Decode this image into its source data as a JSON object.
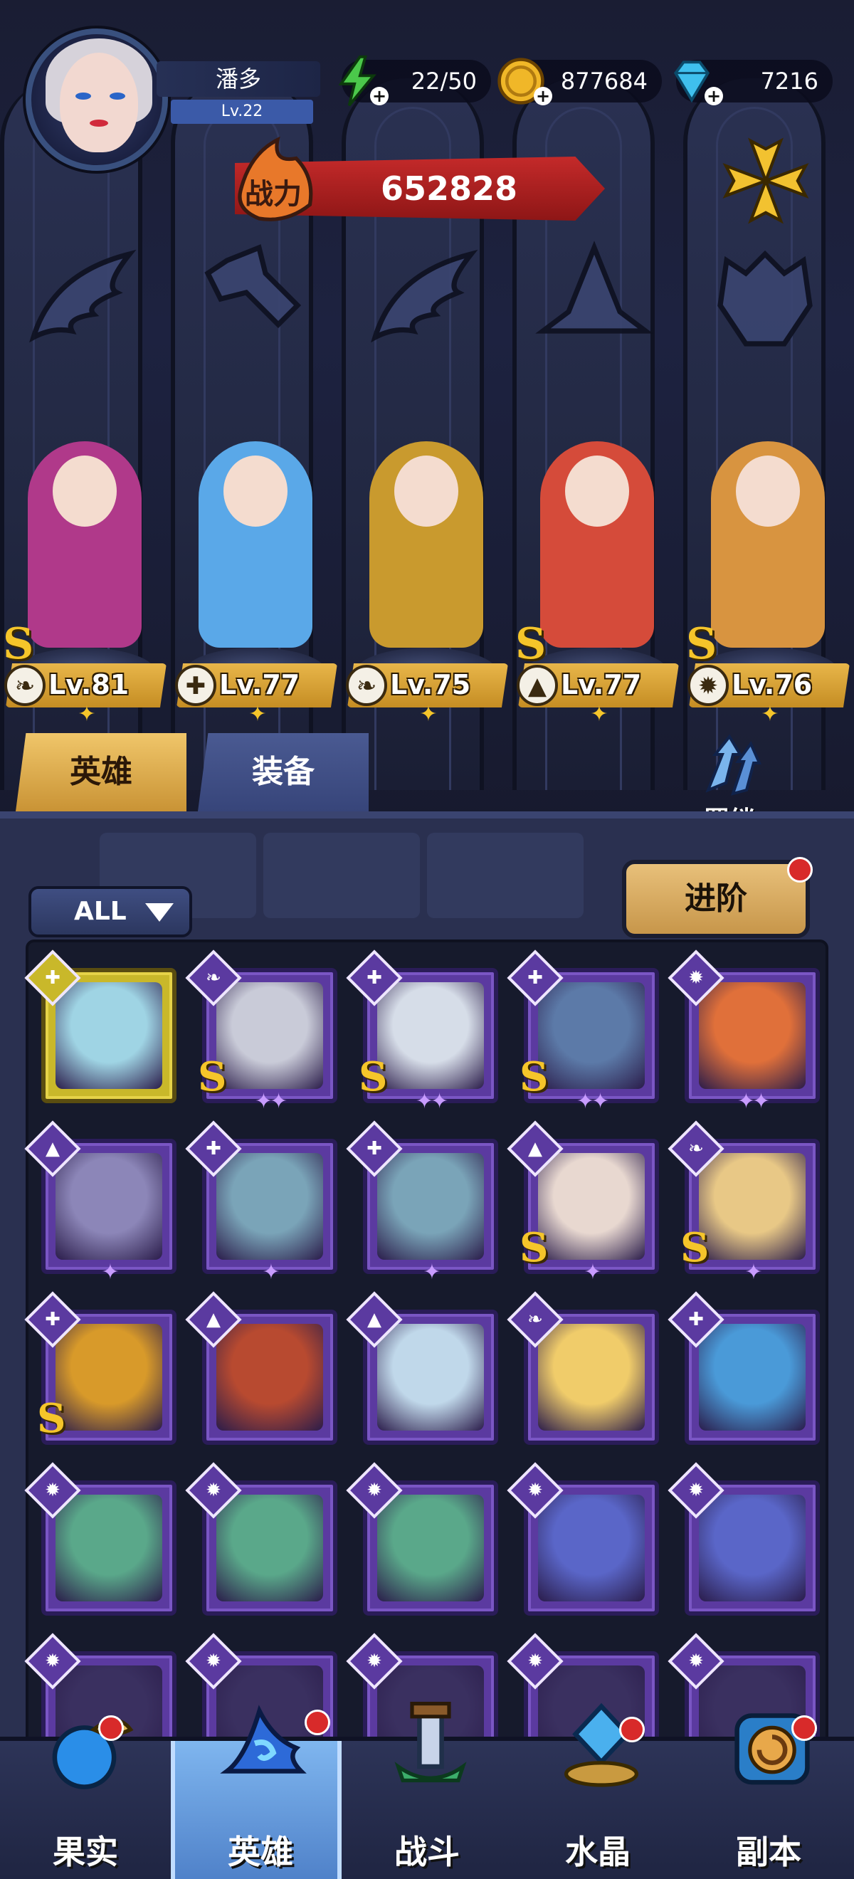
{
  "player": {
    "name": "潘多",
    "level": "Lv.22"
  },
  "resources": {
    "energy": "22/50",
    "gold": "877684",
    "gems": "7216"
  },
  "power": {
    "label": "战力",
    "value": "652828"
  },
  "stage_heroes": [
    {
      "level": "Lv.81",
      "rank": "S",
      "class_icon": "wing-icon",
      "color": "#b0398a"
    },
    {
      "level": "Lv.77",
      "rank": "",
      "class_icon": "wrench-icon",
      "color": "#5aa8e8"
    },
    {
      "level": "Lv.75",
      "rank": "",
      "class_icon": "wing-icon",
      "color": "#c99a2e"
    },
    {
      "level": "Lv.77",
      "rank": "S",
      "class_icon": "hat-icon",
      "color": "#d54b3a"
    },
    {
      "level": "Lv.76",
      "rank": "S",
      "class_icon": "beast-icon",
      "color": "#d89440"
    }
  ],
  "tabs": {
    "heroes": "英雄",
    "equipment": "装备"
  },
  "bond_label": "羁绊",
  "filter": {
    "selected": "ALL"
  },
  "advance_label": "进阶",
  "hero_cards": [
    {
      "class": "wrench",
      "rank": "",
      "stars": 0,
      "frame": "gold",
      "art": "#9fd4e4"
    },
    {
      "class": "wing",
      "rank": "S",
      "stars": 2,
      "frame": "purple",
      "art": "#c9cbd8"
    },
    {
      "class": "wrench",
      "rank": "S",
      "stars": 2,
      "frame": "purple",
      "art": "#d6dde8"
    },
    {
      "class": "wrench",
      "rank": "S",
      "stars": 2,
      "frame": "purple",
      "art": "#5c7aa8"
    },
    {
      "class": "beast",
      "rank": "",
      "stars": 2,
      "frame": "purple",
      "art": "#e0703a"
    },
    {
      "class": "hat",
      "rank": "",
      "stars": 1,
      "frame": "purple",
      "art": "#8c86b8"
    },
    {
      "class": "wrench",
      "rank": "",
      "stars": 1,
      "frame": "purple",
      "art": "#7aa4b8"
    },
    {
      "class": "wrench",
      "rank": "",
      "stars": 1,
      "frame": "purple",
      "art": "#7aa4b8"
    },
    {
      "class": "hat",
      "rank": "S",
      "stars": 1,
      "frame": "purple",
      "art": "#e8d8d0"
    },
    {
      "class": "wing",
      "rank": "S",
      "stars": 1,
      "frame": "purple",
      "art": "#e8c886"
    },
    {
      "class": "wrench",
      "rank": "S",
      "stars": 0,
      "frame": "purple",
      "art": "#d89a2a"
    },
    {
      "class": "hat",
      "rank": "",
      "stars": 0,
      "frame": "purple",
      "art": "#b84a30"
    },
    {
      "class": "hat",
      "rank": "",
      "stars": 0,
      "frame": "purple",
      "art": "#c0d8ea"
    },
    {
      "class": "wing",
      "rank": "",
      "stars": 0,
      "frame": "purple",
      "art": "#f0cc6a"
    },
    {
      "class": "wrench",
      "rank": "",
      "stars": 0,
      "frame": "purple",
      "art": "#4a9ad8"
    },
    {
      "class": "beast",
      "rank": "",
      "stars": 0,
      "frame": "purple",
      "art": "#5aa88a"
    },
    {
      "class": "beast",
      "rank": "",
      "stars": 0,
      "frame": "purple",
      "art": "#5aa88a"
    },
    {
      "class": "beast",
      "rank": "",
      "stars": 0,
      "frame": "purple",
      "art": "#5aa88a"
    },
    {
      "class": "beast",
      "rank": "",
      "stars": 0,
      "frame": "purple",
      "art": "#5a66c8"
    },
    {
      "class": "beast",
      "rank": "",
      "stars": 0,
      "frame": "purple",
      "art": "#5a66c8"
    },
    {
      "class": "beast",
      "rank": "",
      "stars": 0,
      "frame": "purple",
      "art": "#3a3060"
    },
    {
      "class": "beast",
      "rank": "",
      "stars": 0,
      "frame": "purple",
      "art": "#3a3060"
    },
    {
      "class": "beast",
      "rank": "",
      "stars": 0,
      "frame": "purple",
      "art": "#3a3060"
    },
    {
      "class": "beast",
      "rank": "",
      "stars": 0,
      "frame": "purple",
      "art": "#3a3060"
    },
    {
      "class": "beast",
      "rank": "",
      "stars": 0,
      "frame": "purple",
      "art": "#3a3060"
    }
  ],
  "nav": [
    {
      "label": "果实",
      "icon": "fruit-icon",
      "badge": true
    },
    {
      "label": "英雄",
      "icon": "wizard-hat-icon",
      "badge": true
    },
    {
      "label": "战斗",
      "icon": "battle-icon",
      "badge": false
    },
    {
      "label": "水晶",
      "icon": "crystal-icon",
      "badge": true
    },
    {
      "label": "副本",
      "icon": "dungeon-portal-icon",
      "badge": true
    }
  ],
  "colors": {
    "gold": "#f5c52a",
    "panel": "#2a3050",
    "accent_red": "#d82a2a",
    "card_purple": "#5b3aa0"
  }
}
